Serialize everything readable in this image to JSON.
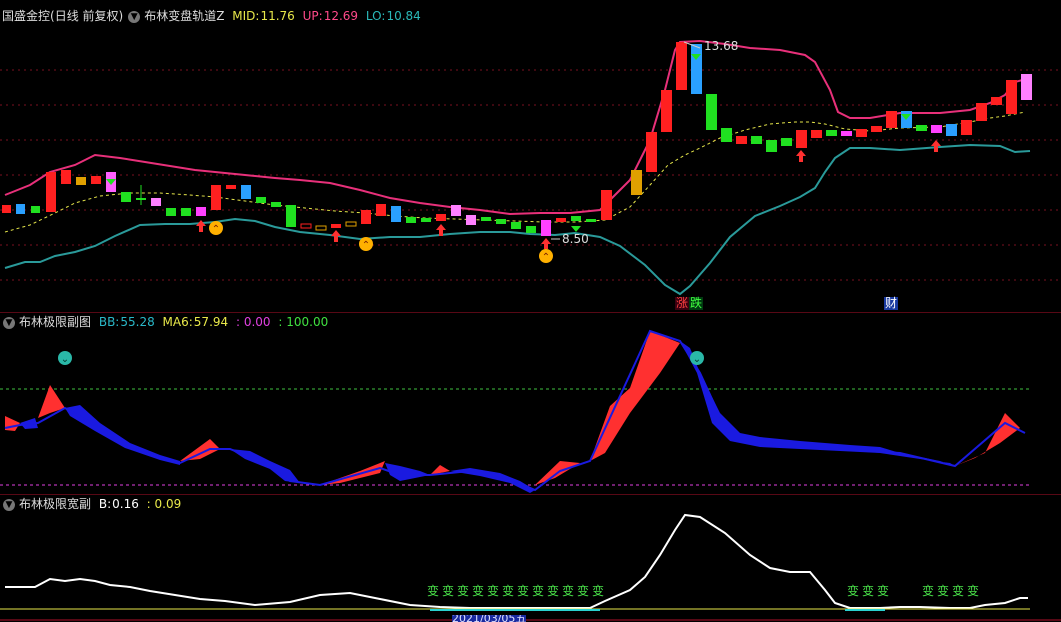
{
  "main": {
    "stock_name": "国盛金控",
    "period": "(日线 前复权)",
    "indicator": "布林变盘轨道Z",
    "mid_label": "MID:",
    "mid_value": "11.76",
    "up_label": "UP:",
    "up_value": "12.69",
    "lo_label": "LO:",
    "lo_value": "10.84",
    "high_marker": "13.68",
    "low_marker": "8.50",
    "tag_zhang": "涨",
    "tag_die": "跌",
    "tag_cai": "财"
  },
  "sub1": {
    "indicator": "布林极限副图",
    "bb_label": "BB:",
    "bb_value": "55.28",
    "ma6_label": "MA6:",
    "ma6_value": "57.94",
    "v3": ": 0.00",
    "v4": ": 100.00"
  },
  "sub2": {
    "indicator": "布林极限宽副",
    "b_label": "B:",
    "b_value": "0.16",
    "v2": ": 0.09",
    "bian_char": "变",
    "date_stub": "2021/03/05五"
  },
  "colors": {
    "bg": "#000000",
    "up_band": "#e8307a",
    "lo_band": "#2a9a9a",
    "mid_line": "#e6e64a",
    "candle_up": "#ff2020",
    "candle_down": "#20e020",
    "bb_up": "#ff3030",
    "bb_down": "#1a1ae0",
    "width_line": "#ffffff",
    "bian": "#49e049"
  }
}
